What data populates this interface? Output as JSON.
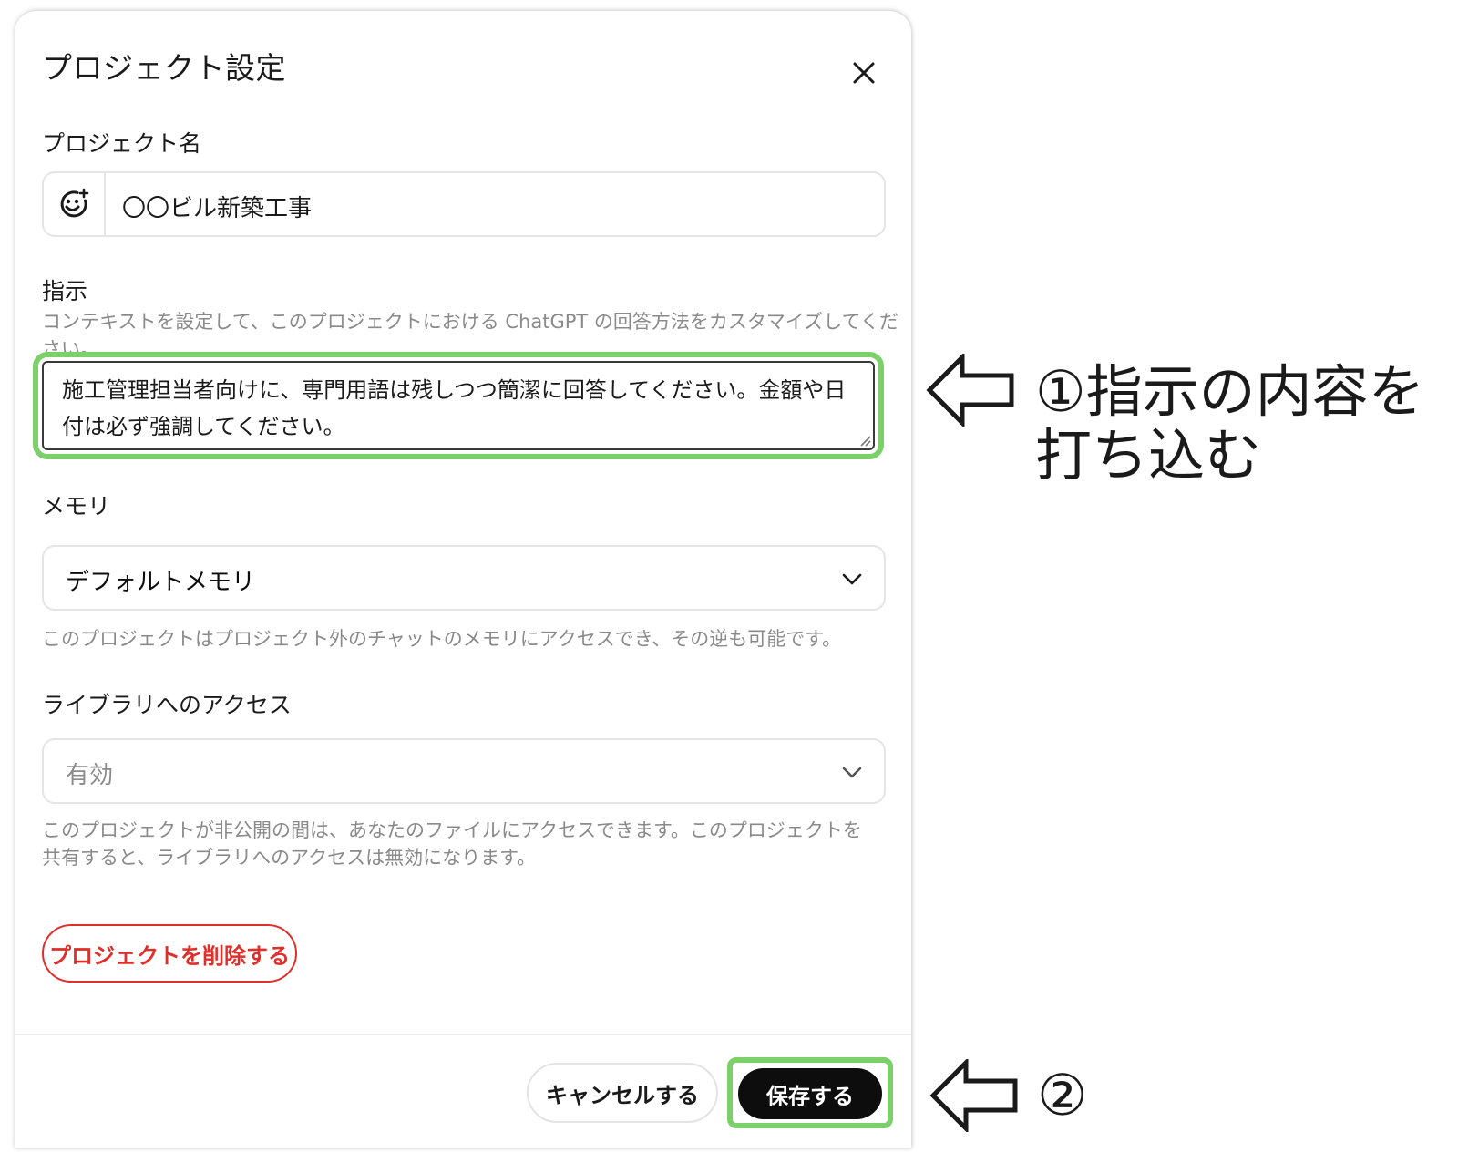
{
  "dialog": {
    "title": "プロジェクト設定",
    "project_name": {
      "label": "プロジェクト名",
      "value": "〇〇ビル新築工事",
      "emoji_icon": "smiley-add-icon"
    },
    "instructions": {
      "label": "指示",
      "hint": "コンテキストを設定して、このプロジェクトにおける ChatGPT の回答方法をカスタマイズしてください。",
      "value": "施工管理担当者向けに、専門用語は残しつつ簡潔に回答してください。金額や日付は必ず強調してください。"
    },
    "memory": {
      "label": "メモリ",
      "selected": "デフォルトメモリ",
      "hint": "このプロジェクトはプロジェクト外のチャットのメモリにアクセスでき、その逆も可能です。"
    },
    "library_access": {
      "label": "ライブラリへのアクセス",
      "selected": "有効",
      "hint": "このプロジェクトが非公開の間は、あなたのファイルにアクセスできます。このプロジェクトを共有すると、ライブラリへのアクセスは無効になります。"
    },
    "delete_label": "プロジェクトを削除する",
    "cancel_label": "キャンセルする",
    "save_label": "保存する"
  },
  "annotations": {
    "step1_line1": "①指示の内容を",
    "step1_line2": "打ち込む",
    "step2": "②"
  },
  "colors": {
    "highlight": "#7bd06a",
    "danger": "#e02e2a",
    "primary_button": "#0d0d0d"
  }
}
